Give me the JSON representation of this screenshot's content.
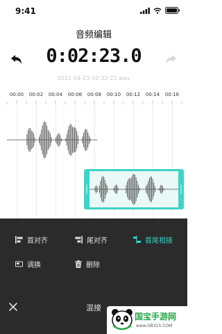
{
  "status_bar": {
    "time": "9:41"
  },
  "header": {
    "title": "音频编辑"
  },
  "player": {
    "time": "0:02:23.0",
    "file_name": "2021-04-23-32-32-22.wav"
  },
  "timeline": {
    "labels": [
      "00:00",
      "00:02",
      "00:04",
      "00:06",
      "00:08",
      "00:10",
      "00:12",
      "00:14",
      "00:16"
    ]
  },
  "options": {
    "align_start": "首对齐",
    "align_end": "尾对齐",
    "head_to_tail": "首尾相接",
    "swap": "调换",
    "delete": "删除"
  },
  "footer": {
    "mix_label": "混接"
  },
  "watermark": {
    "brand": "国宝手游网",
    "url": "www.GB315.COM"
  },
  "colors": {
    "accent": "#2fd3c3",
    "panel": "#2b2b2b",
    "selection": "#3fd3c6"
  }
}
